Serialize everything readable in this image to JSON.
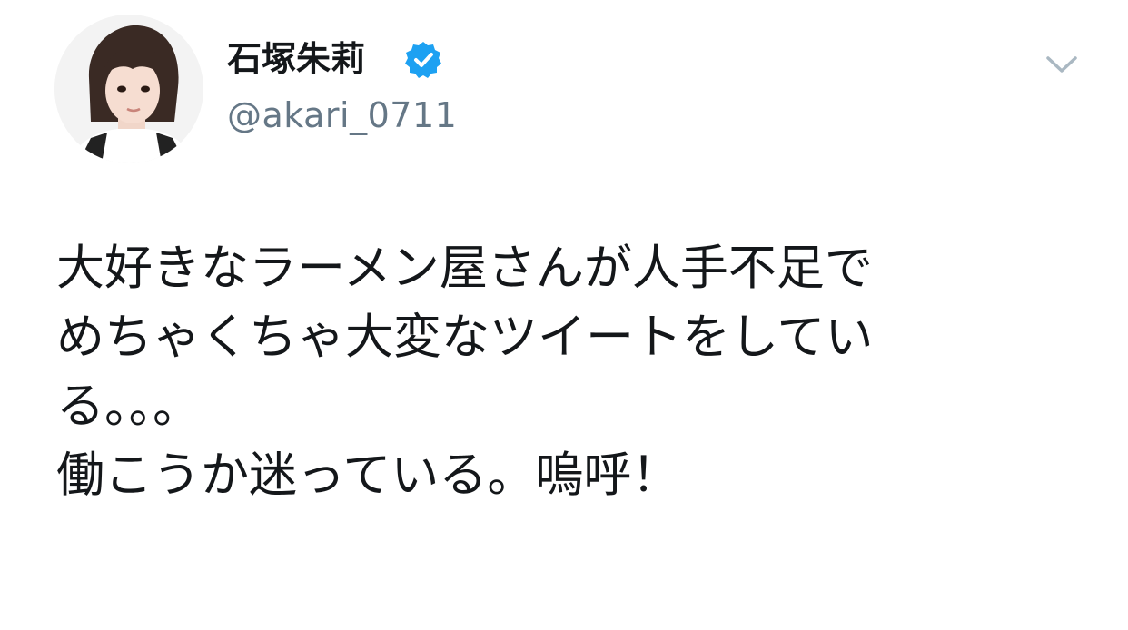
{
  "tweet": {
    "author": {
      "display_name": "石塚朱莉",
      "handle": "@akari_0711",
      "verified": true,
      "avatar_icon": "profile-photo"
    },
    "menu_icon": "chevron-down-icon",
    "text_lines": [
      "大好きなラーメン屋さんが人手不足で",
      "めちゃくちゃ大変なツイートをしてい",
      "る。。。",
      "働こうか迷っている。嗚呼！"
    ]
  },
  "colors": {
    "verified_badge": "#1da1f2",
    "handle": "#657786",
    "text": "#14171a",
    "chevron": "#aab8c2"
  }
}
